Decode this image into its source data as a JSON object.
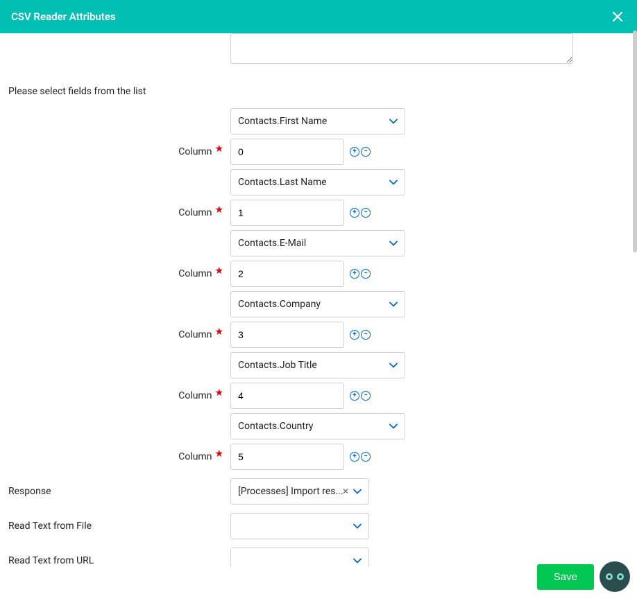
{
  "header": {
    "title": "CSV Reader Attributes"
  },
  "sectionLabel": "Please select fields from the list",
  "columns": [
    {
      "select": "Contacts.First Name",
      "label": "Column",
      "index": "0"
    },
    {
      "select": "Contacts.Last Name",
      "label": "Column",
      "index": "1"
    },
    {
      "select": "Contacts.E-Mail",
      "label": "Column",
      "index": "2"
    },
    {
      "select": "Contacts.Company",
      "label": "Column",
      "index": "3"
    },
    {
      "select": "Contacts.Job Title",
      "label": "Column",
      "index": "4"
    },
    {
      "select": "Contacts.Country",
      "label": "Column",
      "index": "5"
    }
  ],
  "responseLabel": "Response",
  "responseValue": "[Processes] Import res...",
  "readTextFileLabel": "Read Text from File",
  "readTextUrlLabel": "Read Text from URL",
  "saveLabel": "Save",
  "colors": {
    "primary": "#00bfb3",
    "accent": "#0066cc",
    "save": "#00c853",
    "required": "#e30000"
  }
}
